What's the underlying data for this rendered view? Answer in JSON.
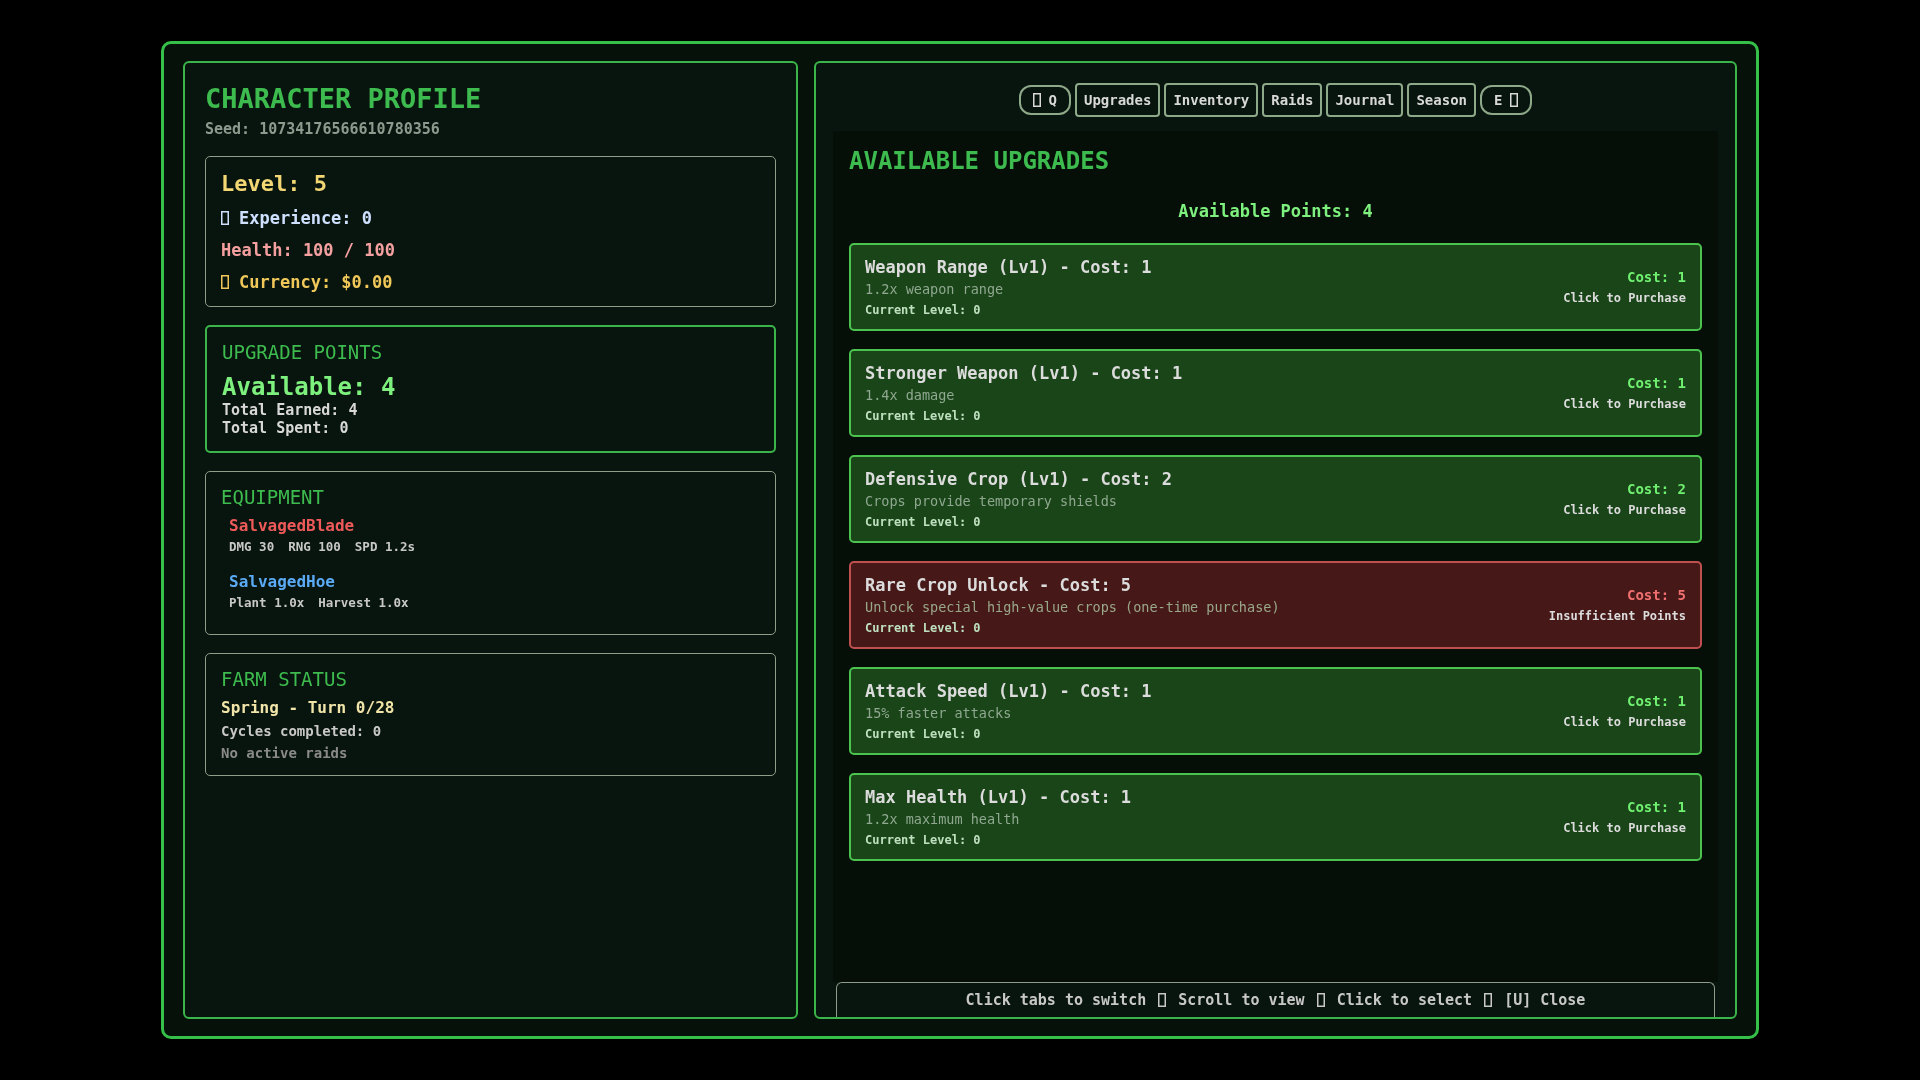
{
  "profile": {
    "title": "CHARACTER PROFILE",
    "seed": "Seed: 10734176566610780356"
  },
  "stats": {
    "level": "Level: 5",
    "experience": "Experience: 0",
    "health": "Health: 100 / 100",
    "currency": "Currency: $0.00"
  },
  "upgrade_points": {
    "title": "UPGRADE POINTS",
    "available": "Available: 4",
    "lines": [
      "Total Earned: 4",
      "Total Spent: 0"
    ]
  },
  "equipment": {
    "title": "EQUIPMENT",
    "items": [
      {
        "name": "SalvagedBlade",
        "kind": "weapon",
        "stats": [
          "DMG 30",
          "RNG 100",
          "SPD 1.2s"
        ]
      },
      {
        "name": "SalvagedHoe",
        "kind": "tool",
        "stats": [
          "Plant 1.0x",
          "Harvest 1.0x"
        ]
      }
    ]
  },
  "farm_status": {
    "title": "FARM STATUS",
    "season": "Spring - Turn 0/28",
    "cycles": "Cycles completed: 0",
    "raids": "No active raids"
  },
  "tabs": [
    {
      "label": "Q",
      "kind": "prev"
    },
    {
      "label": "Upgrades",
      "kind": "tab"
    },
    {
      "label": "Inventory",
      "kind": "tab"
    },
    {
      "label": "Raids",
      "kind": "tab"
    },
    {
      "label": "Journal",
      "kind": "tab"
    },
    {
      "label": "Season",
      "kind": "tab"
    },
    {
      "label": "E",
      "kind": "next"
    }
  ],
  "upgrades_view": {
    "title": "AVAILABLE UPGRADES",
    "points": "Available Points: 4",
    "items": [
      {
        "title": "Weapon Range (Lv1) - Cost: 1",
        "description": "1.2x weapon range",
        "current": "Current Level: 0",
        "cost": "Cost: 1",
        "status": "Click to Purchase",
        "affordable": true
      },
      {
        "title": "Stronger Weapon (Lv1) - Cost: 1",
        "description": "1.4x damage",
        "current": "Current Level: 0",
        "cost": "Cost: 1",
        "status": "Click to Purchase",
        "affordable": true
      },
      {
        "title": "Defensive Crop (Lv1) - Cost: 2",
        "description": "Crops provide temporary shields",
        "current": "Current Level: 0",
        "cost": "Cost: 2",
        "status": "Click to Purchase",
        "affordable": true
      },
      {
        "title": "Rare Crop Unlock - Cost: 5",
        "description": "Unlock special high-value crops (one-time purchase)",
        "current": "Current Level: 0",
        "cost": "Cost: 5",
        "status": "Insufficient Points",
        "affordable": false
      },
      {
        "title": "Attack Speed (Lv1) - Cost: 1",
        "description": "15% faster attacks",
        "current": "Current Level: 0",
        "cost": "Cost: 1",
        "status": "Click to Purchase",
        "affordable": true
      },
      {
        "title": "Max Health (Lv1) - Cost: 1",
        "description": "1.2x maximum health",
        "current": "Current Level: 0",
        "cost": "Cost: 1",
        "status": "Click to Purchase",
        "affordable": true
      }
    ]
  },
  "hints": [
    "Click tabs to switch",
    "Scroll to view",
    "Click to select",
    "[U] Close"
  ]
}
